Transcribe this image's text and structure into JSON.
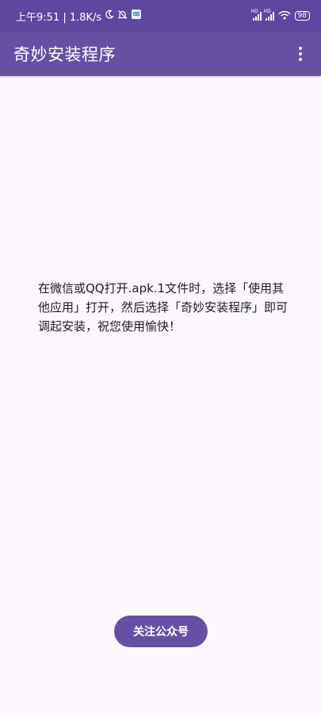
{
  "status_bar": {
    "time_speed": "上午9:51 | 1.8K/s",
    "network_labels": [
      "HD",
      "HD"
    ],
    "battery": "98"
  },
  "app_bar": {
    "title": "奇妙安装程序",
    "menu_icon": "more-vert-icon"
  },
  "main": {
    "message": "在微信或QQ打开.apk.1文件时，选择「使用其他应用」打开，然后选择「奇妙安装程序」即可调起安装，祝您使用愉快！"
  },
  "follow_button": {
    "label": "关注公众号"
  },
  "colors": {
    "primary": "#6750a4",
    "status_bar": "#5f46a0",
    "background": "#fdf8fd"
  }
}
